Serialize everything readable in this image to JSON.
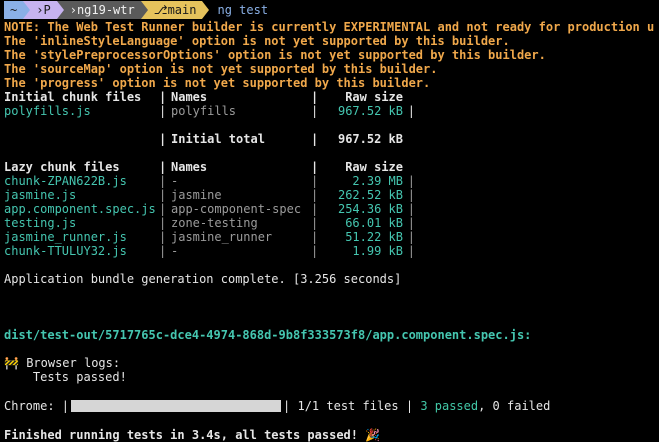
{
  "prompt": {
    "home": "~",
    "folder_p": "P",
    "folder_repo": "ng19-wtr",
    "branch": "main",
    "command": "ng test"
  },
  "warnings": [
    "NOTE: The Web Test Runner builder is currently EXPERIMENTAL and not ready for production use.",
    "The 'inlineStyleLanguage' option is not yet supported by this builder.",
    "The 'stylePreprocessorOptions' option is not yet supported by this builder.",
    "The 'sourceMap' option is not yet supported by this builder.",
    "The 'progress' option is not yet supported by this builder."
  ],
  "initial_table": {
    "headers": [
      "Initial chunk files",
      "Names",
      "Raw size"
    ],
    "rows": [
      {
        "file": "polyfills.js",
        "name": "polyfills",
        "size": "967.52 kB"
      }
    ],
    "total_label": "Initial total",
    "total_size": "967.52 kB"
  },
  "lazy_table": {
    "headers": [
      "Lazy chunk files",
      "Names",
      "Raw size"
    ],
    "rows": [
      {
        "file": "chunk-ZPAN622B.js",
        "name": "-",
        "size": "2.39 MB"
      },
      {
        "file": "jasmine.js",
        "name": "jasmine",
        "size": "262.52 kB"
      },
      {
        "file": "app.component.spec.js",
        "name": "app-component-spec",
        "size": "254.36 kB"
      },
      {
        "file": "testing.js",
        "name": "zone-testing",
        "size": "66.01 kB"
      },
      {
        "file": "jasmine_runner.js",
        "name": "jasmine_runner",
        "size": "51.22 kB"
      },
      {
        "file": "chunk-TTULUY32.js",
        "name": "-",
        "size": "1.99 kB"
      }
    ]
  },
  "bundle_message": "Application bundle generation complete. [3.256 seconds]",
  "test_path": "dist/test-out/5717765c-dce4-4974-868d-9b8f333573f8/app.component.spec.js:",
  "browser_logs_label": "Browser logs:",
  "tests_passed": "Tests passed!",
  "progress": {
    "label": "Chrome: |",
    "fraction": 1.0,
    "after_bar": "| 1/1 test files |",
    "passed": "3 passed",
    "failed_text": ", 0 failed"
  },
  "finished": "Finished running tests in 3.4s, all tests passed!",
  "colors": {
    "background": "#000000",
    "warning": "#f0a84b",
    "cyan": "#45c6b0",
    "dim": "#9b9b9b"
  }
}
